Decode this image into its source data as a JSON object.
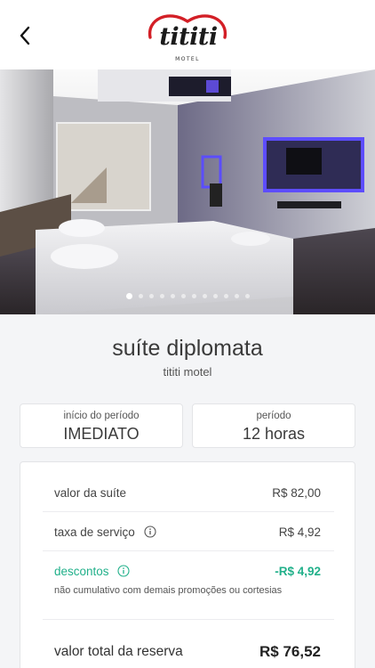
{
  "header": {
    "logo_text": "tititi",
    "logo_subtext": "MOTEL",
    "brand_color": "#d31f26"
  },
  "gallery": {
    "image_count": 12,
    "active_index": 0
  },
  "suite": {
    "name": "suíte diplomata",
    "motel": "tititi motel"
  },
  "period": {
    "start_label": "início do período",
    "start_value": "IMEDIATO",
    "duration_label": "período",
    "duration_value": "12 horas"
  },
  "summary": {
    "suite_label": "valor da suíte",
    "suite_value": "R$ 82,00",
    "service_label": "taxa de serviço",
    "service_value": "R$ 4,92",
    "discount_label": "descontos",
    "discount_value": "-R$ 4,92",
    "discount_note": "não cumulativo com demais promoções ou cortesias",
    "total_label": "valor total da reserva",
    "total_value": "R$ 76,52",
    "discount_color": "#21b08a"
  }
}
